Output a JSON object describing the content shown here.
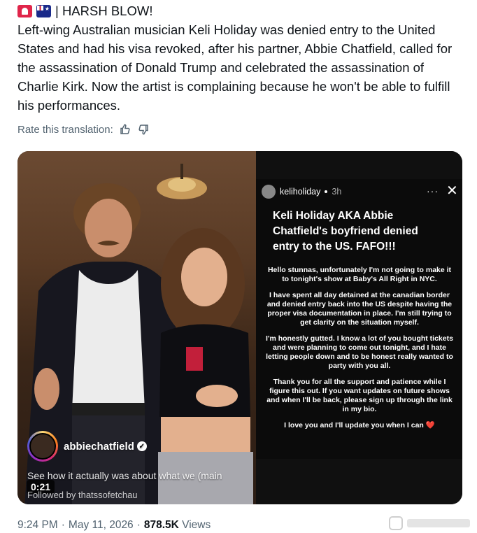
{
  "post": {
    "headline": "| HARSH BLOW!",
    "body": "Left-wing Australian musician Keli Holiday was denied entry to the United States and had his visa revoked, after his partner, Abbie Chatfield, called for the assassination of Donald Trump and celebrated the assassination of Charlie Kirk. Now the artist is complaining because he won't be able to fulfill his performances."
  },
  "rate": {
    "label": "Rate this translation:",
    "icons": [
      "thumbs-up-icon",
      "thumbs-down-icon"
    ]
  },
  "video": {
    "username": "abbiechatfield",
    "caption": "See how it actually was about what we (main",
    "followed_by": "Followed by thatssofetchau",
    "duration": "0:21"
  },
  "story": {
    "username": "keliholiday",
    "time": "3h",
    "more": "···",
    "close": "✕",
    "title": "Keli Holiday AKA Abbie Chatfield's boyfriend denied entry to the US. FAFO!!!",
    "paragraphs": [
      "Hello stunnas, unfortunately I'm not going to make it to tonight's show at Baby's All Right in NYC.",
      "I have spent all day detained at the canadian border and denied entry back into the US despite having the proper visa documentation in place. I'm still trying to get clarity on the situation myself.",
      "I'm honestly gutted. I know a lot of you bought tickets and were planning to come out tonight, and I hate letting people down and to be honest really wanted to party with you all.",
      "Thank you for all the support and patience while I figure this out. If you want updates on future shows and when I'll be back, please sign up through the link in my bio.",
      "I love you and I'll update you when I can ❤️"
    ]
  },
  "meta": {
    "time": "9:24 PM",
    "sep1": "·",
    "date": "May 11, 2026",
    "sep2": "·",
    "views": "878.5K",
    "views_label": "Views"
  },
  "colors": {
    "text": "#0f1419",
    "muted": "#536471",
    "siren": "#e0254a"
  }
}
